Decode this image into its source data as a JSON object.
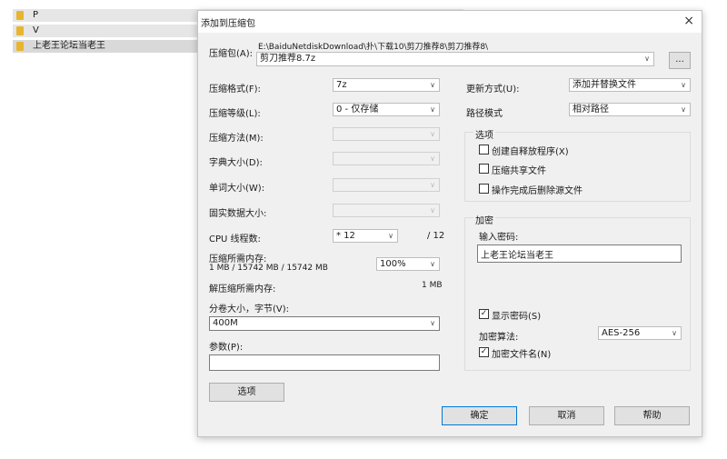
{
  "explorer": {
    "items": [
      {
        "label": "P"
      },
      {
        "label": "V"
      },
      {
        "label": "上老王论坛当老王"
      }
    ]
  },
  "dialog": {
    "title": "添加到压缩包",
    "close_glyph": "×",
    "archive": {
      "label": "压缩包(A):",
      "path": "E:\\BaiduNetdiskDownload\\扑\\下载10\\剪刀推荐8\\剪刀推荐8\\",
      "filename": "剪刀推荐8.7z",
      "browse_label": "..."
    },
    "left": {
      "format": {
        "label": "压缩格式(F):",
        "value": "7z"
      },
      "level": {
        "label": "压缩等级(L):",
        "value": "0 - 仅存储"
      },
      "method": {
        "label": "压缩方法(M):",
        "value": ""
      },
      "dict": {
        "label": "字典大小(D):",
        "value": ""
      },
      "word": {
        "label": "单词大小(W):",
        "value": ""
      },
      "solid": {
        "label": "固实数据大小:",
        "value": ""
      },
      "cpu": {
        "label": "CPU 线程数:",
        "value": "* 12",
        "total": "/ 12"
      },
      "mem_compress": {
        "label": "压缩所需内存:",
        "detail": "1 MB / 15742 MB / 15742 MB",
        "value": "100%"
      },
      "mem_decompress": {
        "label": "解压缩所需内存:",
        "value": "1 MB"
      },
      "volume": {
        "label": "分卷大小，字节(V):",
        "value": "400M"
      },
      "params": {
        "label": "参数(P):",
        "value": ""
      },
      "options_button": "选项"
    },
    "right": {
      "update": {
        "label": "更新方式(U):",
        "value": "添加并替换文件"
      },
      "path_mode": {
        "label": "路径模式",
        "value": "相对路径"
      },
      "options": {
        "title": "选项",
        "sfx": {
          "label": "创建自释放程序(X)",
          "checked": false
        },
        "shared": {
          "label": "压缩共享文件",
          "checked": false
        },
        "delete": {
          "label": "操作完成后删除源文件",
          "checked": false
        }
      },
      "encryption": {
        "title": "加密",
        "password_label": "输入密码:",
        "password": "上老王论坛当老王",
        "show_password": {
          "label": "显示密码(S)",
          "checked": true,
          "mark": "✓"
        },
        "method_label": "加密算法:",
        "method": "AES-256",
        "encrypt_names": {
          "label": "加密文件名(N)",
          "checked": true,
          "mark": "✓"
        }
      }
    },
    "buttons": {
      "ok": "确定",
      "cancel": "取消",
      "help": "帮助"
    }
  }
}
